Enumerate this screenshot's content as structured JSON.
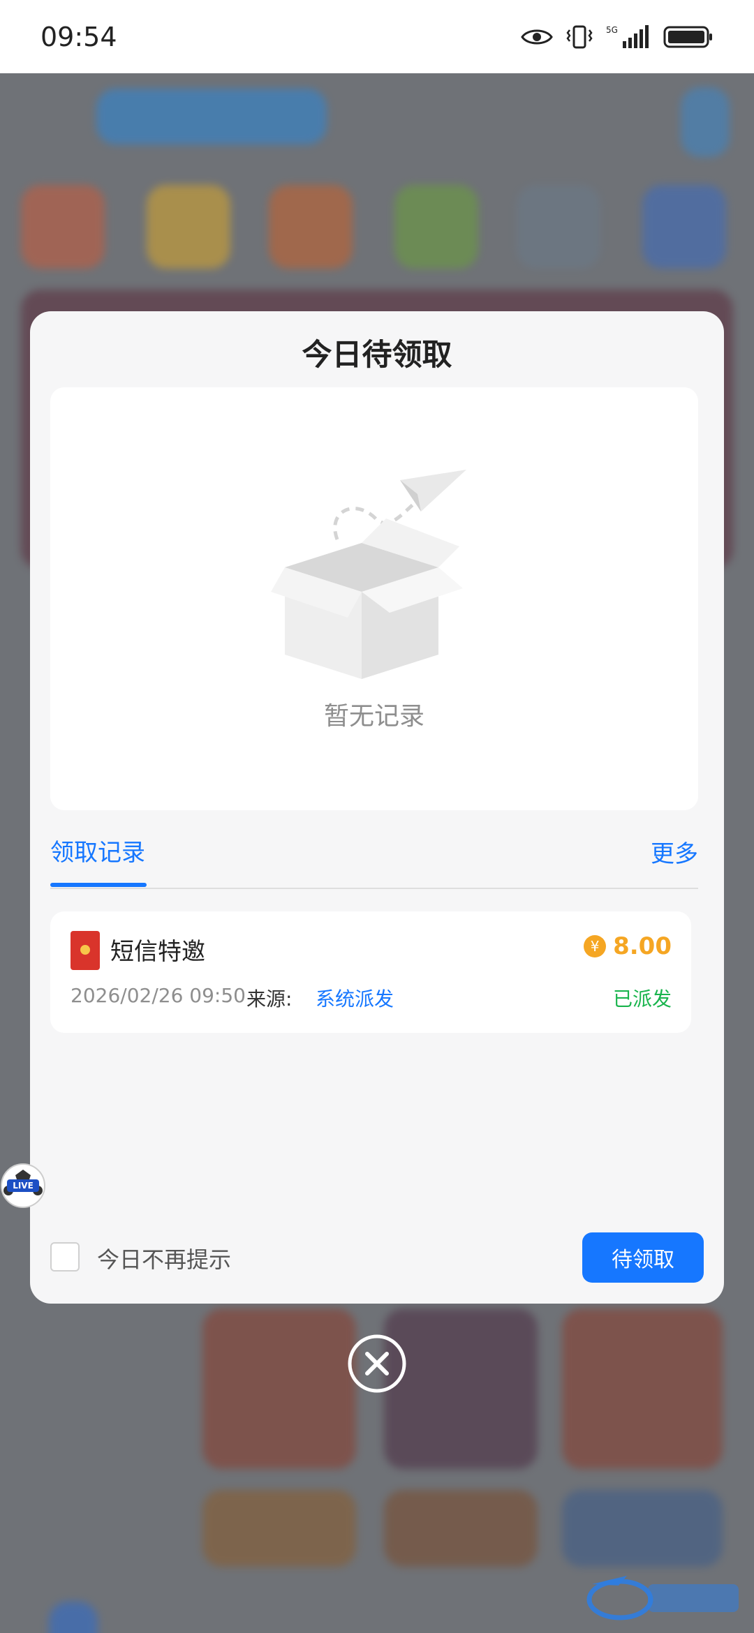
{
  "status_bar": {
    "time": "09:54",
    "network": "5G"
  },
  "modal": {
    "title": "今日待领取",
    "empty_text": "暂无记录",
    "tab_label": "领取记录",
    "more_label": "更多",
    "record": {
      "title": "短信特邀",
      "amount": "8.00",
      "currency_symbol": "¥",
      "datetime": "2026/02/26 09:50",
      "source_label": "来源:",
      "source_value": "系统派发",
      "status": "已派发"
    },
    "dont_show_label": "今日不再提示",
    "claim_button_label": "待领取"
  },
  "live_badge_text": "LIVE",
  "colors": {
    "accent": "#1677ff",
    "amount": "#f5a623",
    "status_done": "#19b44d"
  }
}
